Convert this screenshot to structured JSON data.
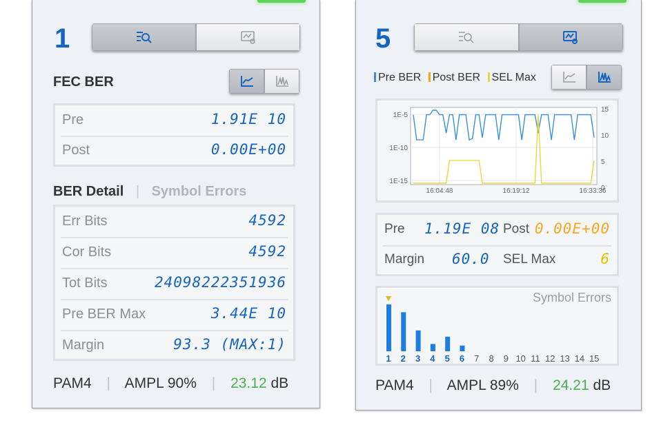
{
  "colors": {
    "accent": "#1565c0",
    "pre": "#3a8fe0",
    "post": "#f5a623",
    "sel": "#e8d840",
    "good": "#4caf50",
    "bar": "#1e7de0"
  },
  "left": {
    "index": "1",
    "view_buttons": [
      {
        "icon": "search-list-icon",
        "active": true
      },
      {
        "icon": "chart-monitor-icon",
        "active": false
      }
    ],
    "fec_title": "FEC BER",
    "fec_mode_buttons": [
      {
        "icon": "line-chart-icon",
        "active": true
      },
      {
        "icon": "bar-chart-icon",
        "active": false
      }
    ],
    "fec_rows": [
      {
        "label": "Pre",
        "value": "1.91E 10"
      },
      {
        "label": "Post",
        "value": "0.00E+00"
      }
    ],
    "tabs": {
      "active": "BER Detail",
      "inactive": "Symbol Errors"
    },
    "detail_rows": [
      {
        "label": "Err Bits",
        "value": "4592"
      },
      {
        "label": "Cor Bits",
        "value": "4592"
      },
      {
        "label": "Tot Bits",
        "value": "24098222351936"
      },
      {
        "label": "Pre BER Max",
        "value": "3.44E 10"
      },
      {
        "label": "Margin",
        "value": "93.3 (MAX:1)"
      }
    ],
    "footer": {
      "mod": "PAM4",
      "ampl": "AMPL 90%",
      "snr": "23.12",
      "unit": "dB"
    }
  },
  "right": {
    "index": "5",
    "view_buttons": [
      {
        "icon": "search-list-icon",
        "active": false
      },
      {
        "icon": "chart-monitor-icon",
        "active": true
      }
    ],
    "legend": [
      "Pre BER",
      "Post BER",
      "SEL Max"
    ],
    "mode_buttons": [
      {
        "icon": "line-chart-icon",
        "active": false
      },
      {
        "icon": "bar-chart-icon",
        "active": true
      }
    ],
    "stats": {
      "pre_label": "Pre",
      "pre_value": "1.19E 08",
      "post_label": "Post",
      "post_value": "0.00E+00",
      "margin_label": "Margin",
      "margin_value": "60.0",
      "sel_label": "SEL Max",
      "sel_value": "6"
    },
    "symbol_title": "Symbol Errors",
    "footer": {
      "mod": "PAM4",
      "ampl": "AMPL 89%",
      "snr": "24.21",
      "unit": "dB"
    }
  },
  "chart_data": [
    {
      "type": "line",
      "title": "",
      "x_ticks": [
        "16:04:48",
        "16:19:12",
        "16:33:36"
      ],
      "y_left_ticks": [
        "1E-5",
        "1E-10",
        "1E-15"
      ],
      "y_right_ticks": [
        "15",
        "10",
        "5",
        "0"
      ],
      "grid": true,
      "series": [
        {
          "name": "Pre BER",
          "values": [
            15,
            9.5,
            9.5,
            9.5,
            15,
            15,
            16,
            16,
            15,
            15,
            11,
            15,
            15,
            9.5,
            15,
            15,
            15,
            9.5,
            9.8,
            15,
            15,
            10,
            15,
            15,
            15,
            15,
            9.5,
            15,
            15,
            15,
            15,
            15,
            15,
            9.5,
            15,
            15,
            15,
            15,
            11,
            15,
            15,
            15,
            9.5,
            15,
            15,
            15,
            15,
            15,
            15,
            9.5,
            15,
            15,
            15,
            15,
            15,
            10
          ]
        },
        {
          "name": "SEL Max",
          "values": [
            0,
            0,
            0,
            0,
            0,
            0,
            0,
            0,
            0,
            0,
            0,
            5,
            5,
            5,
            5,
            5,
            5,
            5,
            5,
            5,
            5,
            0,
            0,
            0,
            0,
            0,
            0,
            0,
            0,
            0,
            0,
            0,
            0,
            0,
            0,
            0,
            0,
            0,
            15,
            0,
            0,
            0,
            0,
            0,
            0,
            0,
            0,
            0,
            0,
            0,
            0,
            0,
            0,
            0,
            0,
            5
          ]
        },
        {
          "name": "Post BER",
          "values": []
        }
      ]
    },
    {
      "type": "bar",
      "title": "Symbol Errors",
      "categories": [
        "1",
        "2",
        "3",
        "4",
        "5",
        "6",
        "7",
        "8",
        "9",
        "10",
        "11",
        "12",
        "13",
        "14",
        "15"
      ],
      "values": [
        9,
        7.5,
        4,
        1.4,
        2.8,
        1.1,
        0,
        0,
        0,
        0,
        0,
        0,
        0,
        0,
        0
      ],
      "marker_category": "1"
    }
  ]
}
